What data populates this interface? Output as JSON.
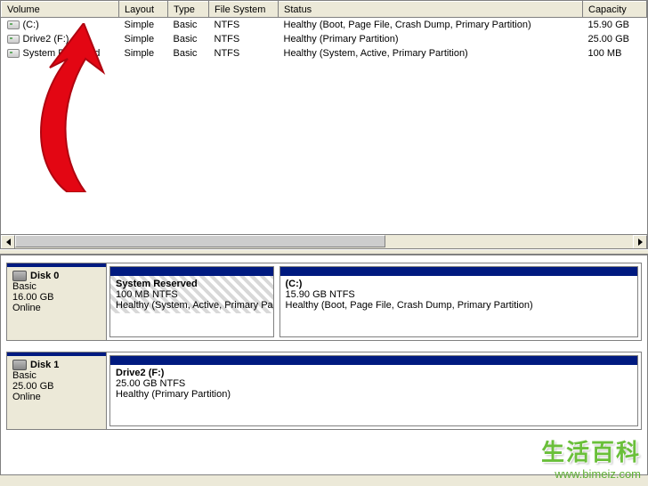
{
  "columns": {
    "volume": "Volume",
    "layout": "Layout",
    "type": "Type",
    "filesystem": "File System",
    "status": "Status",
    "capacity": "Capacity"
  },
  "volumes": [
    {
      "name": "(C:)",
      "layout": "Simple",
      "type": "Basic",
      "fs": "NTFS",
      "status": "Healthy (Boot, Page File, Crash Dump, Primary Partition)",
      "capacity": "15.90 GB"
    },
    {
      "name": "Drive2 (F:)",
      "layout": "Simple",
      "type": "Basic",
      "fs": "NTFS",
      "status": "Healthy (Primary Partition)",
      "capacity": "25.00 GB"
    },
    {
      "name": "System Reserved",
      "layout": "Simple",
      "type": "Basic",
      "fs": "NTFS",
      "status": "Healthy (System, Active, Primary Partition)",
      "capacity": "100 MB"
    }
  ],
  "disks": [
    {
      "name": "Disk 0",
      "type": "Basic",
      "size": "16.00 GB",
      "state": "Online",
      "partitions": [
        {
          "title": "System Reserved",
          "sub": "100 MB NTFS",
          "status": "Healthy (System, Active, Primary Partition)",
          "hatched": true,
          "flex": 1
        },
        {
          "title": "(C:)",
          "sub": "15.90 GB NTFS",
          "status": "Healthy (Boot, Page File, Crash Dump, Primary Partition)",
          "hatched": false,
          "flex": 2.2
        }
      ]
    },
    {
      "name": "Disk 1",
      "type": "Basic",
      "size": "25.00 GB",
      "state": "Online",
      "partitions": [
        {
          "title": "Drive2 (F:)",
          "sub": "25.00 GB NTFS",
          "status": "Healthy (Primary Partition)",
          "hatched": false,
          "flex": 1
        }
      ]
    }
  ],
  "watermark": {
    "text": "生活百科",
    "url": "www.bimeiz.com"
  },
  "colors": {
    "headerStripe": "#001a80",
    "arrow": "#e30613"
  }
}
